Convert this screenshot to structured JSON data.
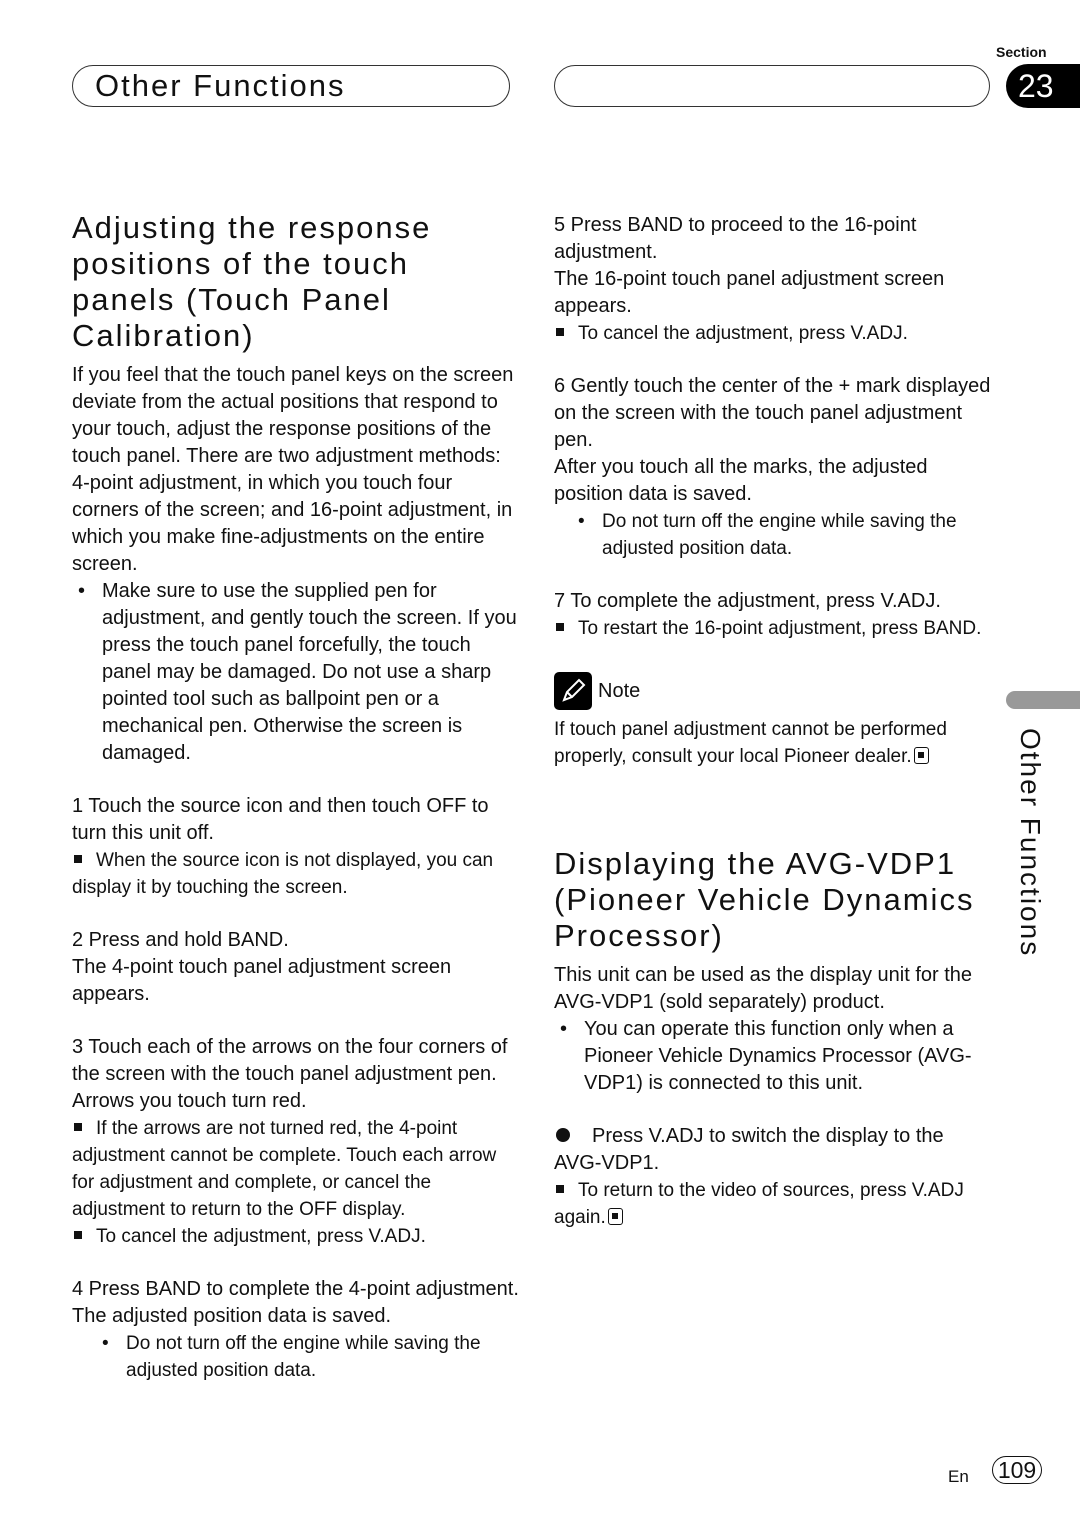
{
  "header": {
    "title": "Other Functions",
    "section_label": "Section",
    "section_number": "23"
  },
  "left": {
    "heading": "Adjusting the response positions of the touch panels (Touch Panel Calibration)",
    "intro": "If you feel that the touch panel keys on the screen deviate from the actual positions that respond to your touch, adjust the response positions of the touch panel. There are two adjustment methods: 4-point adjustment, in which you touch four corners of the screen; and 16-point adjustment, in which you make fine-adjustments on the entire screen.",
    "intro_bullet": "Make sure to use the supplied pen for adjustment, and gently touch the screen. If you press the touch panel forcefully, the touch panel may be damaged. Do not use a sharp pointed tool such as ballpoint pen or a mechanical pen. Otherwise the screen is damaged.",
    "step1": "1   Touch the source icon and then touch OFF to turn this unit off.",
    "step1_note": "When the source icon is not displayed, you can display it by touching the screen.",
    "step2": "2   Press and hold BAND.",
    "step2_body": "The 4-point touch panel adjustment screen appears.",
    "step3": "3   Touch each of the arrows on the four corners of the screen with the touch panel adjustment pen.",
    "step3_body": "Arrows you touch turn red.",
    "step3_note1": "If the arrows are not turned red, the 4-point adjustment cannot be complete. Touch each arrow for adjustment and complete, or cancel the adjustment to return to the OFF display.",
    "step3_note2": "To cancel the adjustment, press V.ADJ.",
    "step4": "4   Press BAND to complete the 4-point adjustment.",
    "step4_body": "The adjusted position data is saved.",
    "step4_bullet": "Do not turn off the engine while saving the adjusted position data."
  },
  "right": {
    "step5": "5   Press BAND to proceed to the 16-point adjustment.",
    "step5_body": "The 16-point touch panel adjustment screen appears.",
    "step5_note": "To cancel the adjustment, press V.ADJ.",
    "step6": "6   Gently touch the center of the + mark displayed on the screen with the touch panel adjustment pen.",
    "step6_body": "After you touch all the marks, the adjusted position data is saved.",
    "step6_bullet": "Do not turn off the engine while saving the adjusted position data.",
    "step7": "7   To complete the adjustment, press V.ADJ.",
    "step7_note": "To restart the 16-point adjustment, press BAND.",
    "note_label": "Note",
    "note_text": "If touch panel adjustment cannot be performed properly, consult your local Pioneer dealer.",
    "heading2": "Displaying the AVG-VDP1 (Pioneer Vehicle Dynamics Processor)",
    "intro2": "This unit can be used as the display unit for the AVG-VDP1 (sold separately) product.",
    "intro2_bullet": "You can operate this function only when a Pioneer Vehicle Dynamics Processor (AVG-VDP1) is connected to this unit.",
    "action": "Press V.ADJ to switch the display to the AVG-VDP1.",
    "action_note": "To return to the video of sources, press V.ADJ again."
  },
  "side_tab_label": "Other Functions",
  "footer": {
    "lang": "En",
    "page": "109"
  }
}
